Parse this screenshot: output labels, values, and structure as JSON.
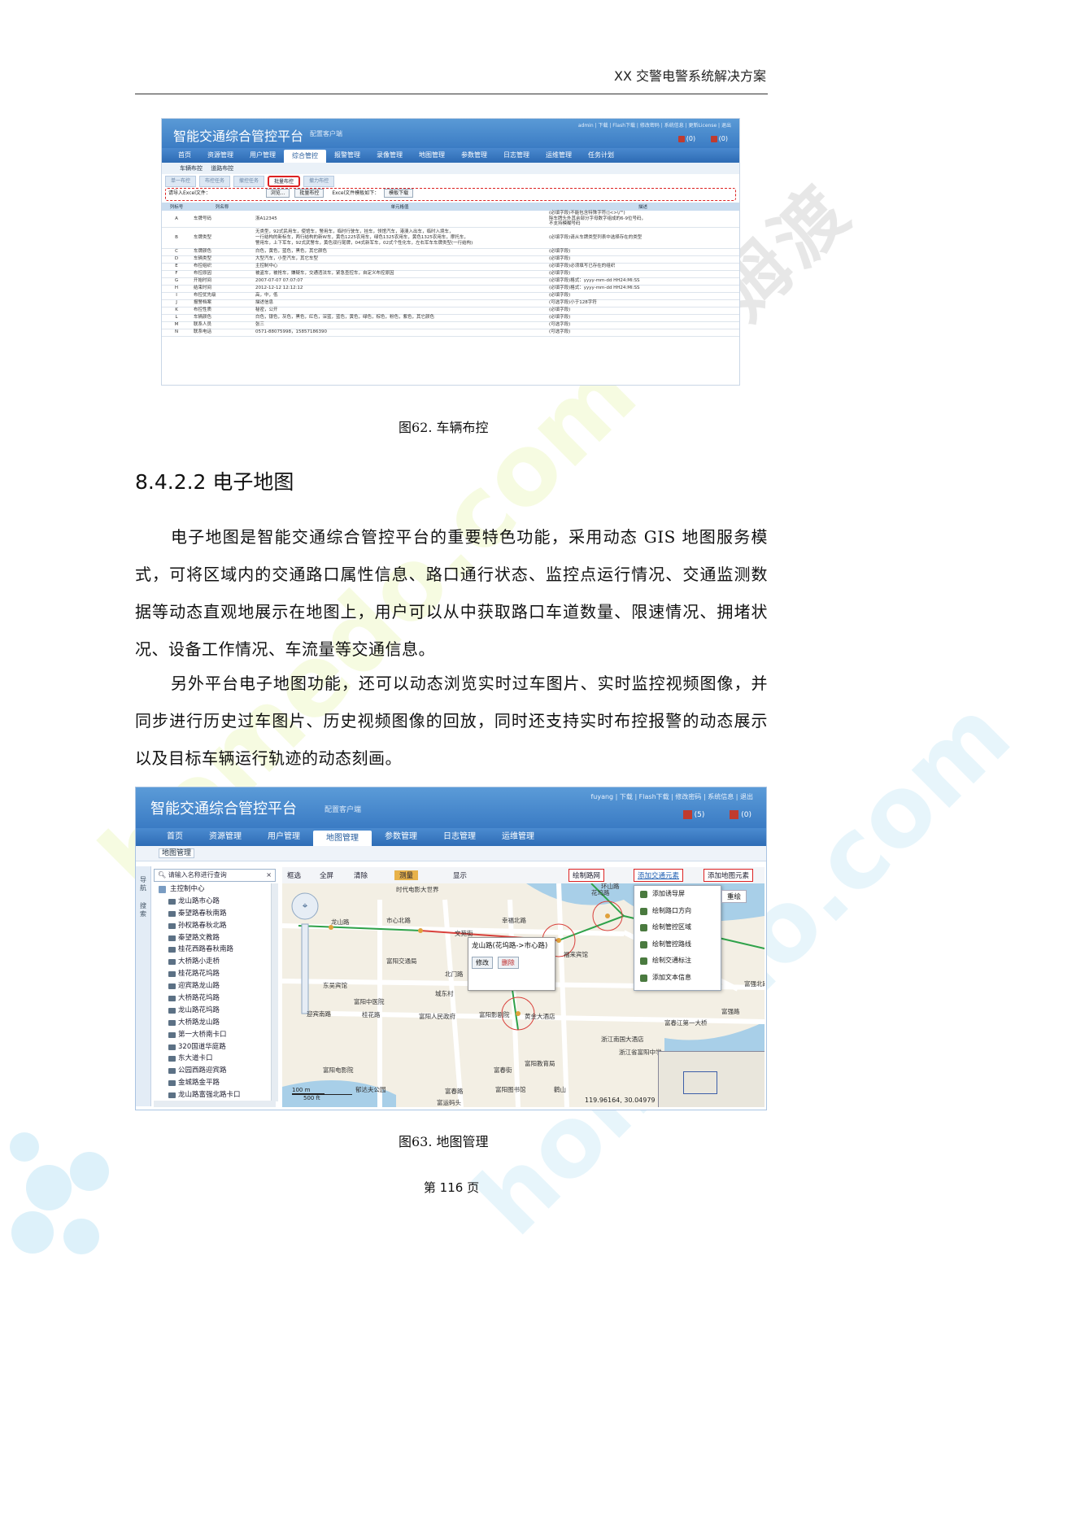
{
  "header": {
    "title": "XX 交警电警系统解决方案"
  },
  "figure62": {
    "brand": "智能交通综合管控平台",
    "subtitle": "配置客户端",
    "top_links": "admin  |  下载  |  Flash下载  |  修改密码  |  系统信息  |  更新License  |  退出",
    "alarm_a": "(0)",
    "alarm_b": "(0)",
    "nav": [
      "首页",
      "资源管理",
      "用户管理",
      "综合管控",
      "报警管理",
      "录像管理",
      "地图管理",
      "参数管理",
      "日志管理",
      "运维管理",
      "任务计划"
    ],
    "active_nav": 3,
    "subnav": [
      "车辆布控",
      "道路布控"
    ],
    "tabs": [
      "单一布控",
      "布控任务",
      "撤控任务",
      "批量布控",
      "撤力布控"
    ],
    "active_tab": 3,
    "toolbar": {
      "label": "请导入Excel文件：",
      "browse": "浏览...",
      "batch": "批量布控",
      "template_label": "Excel文件模板如下：",
      "download": "模板下载"
    },
    "columns": [
      "列标号",
      "列名称",
      "单元格值",
      "描述"
    ],
    "rows": [
      {
        "id": "A",
        "name": "车牌号码",
        "value": "浙A12345",
        "desc": "(必填字段)不能包含特殊字符(]<>\\/'\")\n除车牌头外其余部分字母数字组成的6-9位号码，\n不支持模糊号码"
      },
      {
        "id": "B",
        "name": "车牌类型",
        "value": "无类型，92式民用车，使馆车，警用车，临时行驶车，挂车，领馆汽车，港澳入出车，临时入境车，\n一行结构的新标车，两行结构的新W车，黄色1225农用车，绿色1325农用车，黄色1325农用车，摩托车，\n警用车，上下军车，92式武警车，黄色双行尾牌，04式新军车，02式个性化车，左右军车车牌类型(一行结构)",
        "desc": "(必填字段)请从车牌类型列表中选择存在的类型"
      },
      {
        "id": "C",
        "name": "车牌颜色",
        "value": "白色，黄色，蓝色，黑色，其它颜色",
        "desc": "(必填字段)"
      },
      {
        "id": "D",
        "name": "车辆类型",
        "value": "大型汽车，小型汽车，其它车型",
        "desc": "(必填字段)"
      },
      {
        "id": "E",
        "name": "布控组织",
        "value": "主控制中心",
        "desc": "(必填字段)必须填写已存在的组织"
      },
      {
        "id": "F",
        "name": "布控原因",
        "value": "被盗车，被抢车，嫌疑车，交通违法车，紧急查控车，自定义布控原因",
        "desc": "(必填字段)"
      },
      {
        "id": "G",
        "name": "开始时间",
        "value": "2007-07-07 07:07:07",
        "desc": "(必填字段)格式：yyyy-mm-dd HH24:MI:SS"
      },
      {
        "id": "H",
        "name": "结束时间",
        "value": "2012-12-12 12:12:12",
        "desc": "(必填字段)格式：yyyy-mm-dd HH24:MI:SS"
      },
      {
        "id": "I",
        "name": "布控优先级",
        "value": "高，中，低",
        "desc": "(必填字段)"
      },
      {
        "id": "J",
        "name": "报警档案",
        "value": "描述信息",
        "desc": "(可选字段)小于128字符"
      },
      {
        "id": "K",
        "name": "布控性质",
        "value": "秘密，公开",
        "desc": "(必填字段)"
      },
      {
        "id": "L",
        "name": "车辆颜色",
        "value": "白色，银色，灰色，黑色，红色，深蓝，蓝色，黄色，绿色，棕色，粉色，紫色，其它颜色",
        "desc": "(必填字段)"
      },
      {
        "id": "M",
        "name": "联系人员",
        "value": "张三",
        "desc": "(可选字段)"
      },
      {
        "id": "N",
        "name": "联系电话",
        "value": "0571-88075998，15857186390",
        "desc": "(可选字段)"
      }
    ]
  },
  "captions": {
    "fig62": "图62.  车辆布控",
    "fig63": "图63.  地图管理"
  },
  "section_title": "8.4.2.2  电子地图",
  "paragraphs": [
    "电子地图是智能交通综合管控平台的重要特色功能，采用动态 GIS 地图服务模式，可将区域内的交通路口属性信息、路口通行状态、监控点运行情况、交通监测数据等动态直观地展示在地图上，用户可以从中获取路口车道数量、限速情况、拥堵状况、设备工作情况、车流量等交通信息。",
    "另外平台电子地图功能，还可以动态浏览实时过车图片、实时监控视频图像，并同步进行历史过车图片、历史视频图像的回放，同时还支持实时布控报警的动态展示以及目标车辆运行轨迹的动态刻画。"
  ],
  "figure63": {
    "brand": "智能交通综合管控平台",
    "subtitle": "配置客户端",
    "top_links": "fuyang  |  下载  |  Flash下载  |  修改密码  |  系统信息  |  退出",
    "alarm_a": "(5)",
    "alarm_b": "(0)",
    "nav": [
      "首页",
      "资源管理",
      "用户管理",
      "地图管理",
      "参数管理",
      "日志管理",
      "运维管理"
    ],
    "active_nav": 3,
    "subnav": "地图管理",
    "side_tabs": [
      "导航",
      "搜索"
    ],
    "search_placeholder": "请输入名称进行查询",
    "tree_root": "主控制中心",
    "tree_items": [
      "龙山路市心路",
      "秦望路春秋南路",
      "孙权路春秋北路",
      "秦望路文教路",
      "桂花西路春秋南路",
      "大桥路小走桥",
      "桂花路花坞路",
      "迎宾路龙山路",
      "大桥路花坞路",
      "龙山路花坞路",
      "大桥路龙山路",
      "第一大桥南卡口",
      "320国道华庭路",
      "东大道卡口",
      "公园西路迎宾路",
      "金城路金平路",
      "龙山路富强北路卡口"
    ],
    "toolbar": {
      "select": "框选",
      "full": "全屏",
      "clear": "清除",
      "measure": "测量",
      "display": "显示",
      "draw_network": "绘制路网",
      "add_traffic": "添加交通元素",
      "add_map": "添加地图元素"
    },
    "menu": [
      "添加诱导屏",
      "绘制路口方向",
      "绘制管控区域",
      "绘制管控路线",
      "绘制交通标注",
      "添加文本信息"
    ],
    "reset": "重绘",
    "popup": {
      "title": "龙山路(花坞路->市心路)",
      "edit": "修改",
      "delete": "删除"
    },
    "map_labels": [
      "时代电影大世界",
      "市心北路",
      "龙山路",
      "文苑街",
      "富阳交通局",
      "北门路",
      "东吴宾馆",
      "富阳中医院",
      "城东村",
      "迎宾南路",
      "桂花路",
      "富阳人民政府",
      "富阳影剧院",
      "黄金大酒店",
      "金桥路",
      "富阳电影院",
      "郁达夫公园",
      "富春路",
      "富阳教育局",
      "浙江省富阳中学",
      "富春江第一大桥",
      "鹳山",
      "富阳图书馆",
      "环山路",
      "富强北路",
      "幸福北路",
      "花坞路",
      "福来宾馆",
      "富春街",
      "国际会堂中心大酒店",
      "中港大酒店",
      "双君",
      "苋浦",
      "春云浦",
      "浙江南国大酒店",
      "富强路",
      "富运码头"
    ],
    "scale_m": "100 m",
    "scale_ft": "500 ft",
    "coords": "119.96164, 30.04979"
  },
  "footer": "第 116 页",
  "watermark": {
    "text_a": "homedo.com",
    "text_b": "河姆渡"
  }
}
